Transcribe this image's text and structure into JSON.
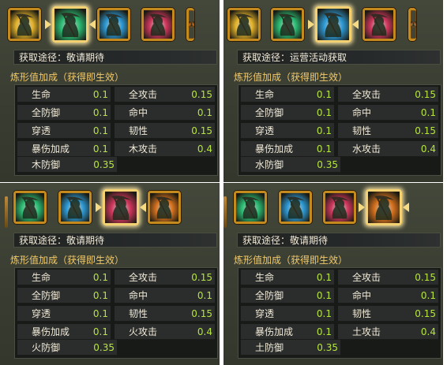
{
  "panels": [
    {
      "id": "wood",
      "source_label": "获取途径：",
      "source_value": "敬请期待",
      "bonus_title": "炼形值加成（获得即生效）",
      "icons": [
        {
          "name": "gold-reaper-icon",
          "color": "#e7b52c"
        },
        {
          "name": "green-reaper-icon",
          "color": "#2bbd74",
          "selected": true
        },
        {
          "name": "blue-reaper-icon",
          "color": "#2d9ad6"
        },
        {
          "name": "red-reaper-icon",
          "color": "#d2375e"
        },
        {
          "name": "orange-reaper-icon",
          "color": "#d8721e",
          "partial": true
        }
      ],
      "stats": [
        {
          "name": "生命",
          "value": "0.1"
        },
        {
          "name": "全攻击",
          "value": "0.15"
        },
        {
          "name": "全防御",
          "value": "0.1"
        },
        {
          "name": "命中",
          "value": "0.1"
        },
        {
          "name": "穿透",
          "value": "0.1"
        },
        {
          "name": "韧性",
          "value": "0.15"
        },
        {
          "name": "暴伤加成",
          "value": "0.1"
        },
        {
          "name": "木攻击",
          "value": "0.4"
        },
        {
          "name": "木防御",
          "value": "0.35"
        }
      ]
    },
    {
      "id": "water",
      "source_label": "获取途径：",
      "source_value": "运营活动获取",
      "bonus_title": "炼形值加成（获得即生效）",
      "icons": [
        {
          "name": "gold-reaper-icon",
          "color": "#e7b52c"
        },
        {
          "name": "green-reaper-icon",
          "color": "#2bbd74"
        },
        {
          "name": "blue-reaper-icon",
          "color": "#2d9ad6",
          "selected": true
        },
        {
          "name": "red-reaper-icon",
          "color": "#d2375e"
        },
        {
          "name": "orange-reaper-icon",
          "color": "#d8721e",
          "partial": true
        }
      ],
      "stats": [
        {
          "name": "生命",
          "value": "0.1"
        },
        {
          "name": "全攻击",
          "value": "0.15"
        },
        {
          "name": "全防御",
          "value": "0.1"
        },
        {
          "name": "命中",
          "value": "0.1"
        },
        {
          "name": "穿透",
          "value": "0.1"
        },
        {
          "name": "韧性",
          "value": "0.15"
        },
        {
          "name": "暴伤加成",
          "value": "0.1"
        },
        {
          "name": "水攻击",
          "value": "0.4"
        },
        {
          "name": "水防御",
          "value": "0.35"
        }
      ]
    },
    {
      "id": "fire",
      "source_label": "获取途径：",
      "source_value": "敬请期待",
      "bonus_title": "炼形值加成（获得即生效）",
      "icons": [
        {
          "name": "green-reaper-icon",
          "color": "#2bbd74"
        },
        {
          "name": "blue-reaper-icon",
          "color": "#2d9ad6"
        },
        {
          "name": "red-reaper-icon",
          "color": "#d2375e",
          "selected": true
        },
        {
          "name": "orange-reaper-icon",
          "color": "#d8721e"
        }
      ],
      "stats": [
        {
          "name": "生命",
          "value": "0.1"
        },
        {
          "name": "全攻击",
          "value": "0.15"
        },
        {
          "name": "全防御",
          "value": "0.1"
        },
        {
          "name": "命中",
          "value": "0.1"
        },
        {
          "name": "穿透",
          "value": "0.1"
        },
        {
          "name": "韧性",
          "value": "0.15"
        },
        {
          "name": "暴伤加成",
          "value": "0.1"
        },
        {
          "name": "火攻击",
          "value": "0.4"
        },
        {
          "name": "火防御",
          "value": "0.35"
        }
      ]
    },
    {
      "id": "earth",
      "source_label": "获取途径：",
      "source_value": "敬请期待",
      "bonus_title": "炼形值加成（获得即生效）",
      "icons": [
        {
          "name": "green-reaper-icon",
          "color": "#2bbd74"
        },
        {
          "name": "blue-reaper-icon",
          "color": "#2d9ad6"
        },
        {
          "name": "red-reaper-icon",
          "color": "#d2375e"
        },
        {
          "name": "orange-reaper-icon",
          "color": "#d8721e",
          "selected": true
        }
      ],
      "stats": [
        {
          "name": "生命",
          "value": "0.1"
        },
        {
          "name": "全攻击",
          "value": "0.15"
        },
        {
          "name": "全防御",
          "value": "0.1"
        },
        {
          "name": "命中",
          "value": "0.1"
        },
        {
          "name": "穿透",
          "value": "0.1"
        },
        {
          "name": "韧性",
          "value": "0.15"
        },
        {
          "name": "暴伤加成",
          "value": "0.1"
        },
        {
          "name": "土攻击",
          "value": "0.4"
        },
        {
          "name": "土防御",
          "value": "0.35"
        }
      ]
    }
  ]
}
